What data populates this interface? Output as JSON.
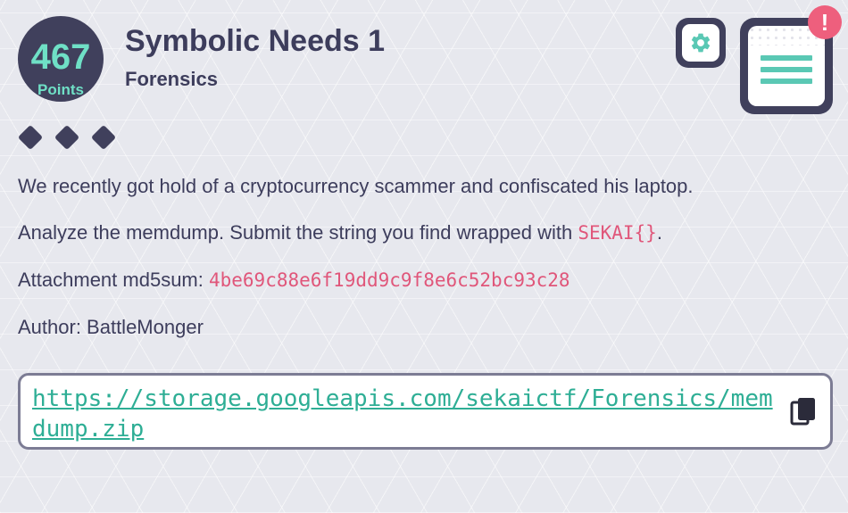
{
  "challenge": {
    "points": "467",
    "points_label": "Points",
    "title": "Symbolic Needs 1",
    "category": "Forensics",
    "difficulty_diamonds": 3
  },
  "description": {
    "line1": "We recently got hold of a cryptocurrency scammer and confiscated his laptop.",
    "line2_prefix": "Analyze the memdump. Submit the string you find wrapped with ",
    "line2_code": "SEKAI{}",
    "line2_suffix": ".",
    "line3_prefix": "Attachment md5sum: ",
    "line3_code": "4be69c88e6f19dd9c9f8e6c52bc93c28",
    "line4": "Author: BattleMonger"
  },
  "attachment": {
    "url": "https://storage.googleapis.com/sekaictf/Forensics/memdump.zip"
  },
  "header": {
    "notification_badge": "!"
  },
  "icons": {
    "settings": "gear-icon",
    "menu": "menu-icon",
    "copy": "copy-icon"
  },
  "colors": {
    "accent": "#5ac8b4",
    "dark": "#40405c",
    "code": "#e0567a",
    "alert": "#ee5f7d"
  }
}
